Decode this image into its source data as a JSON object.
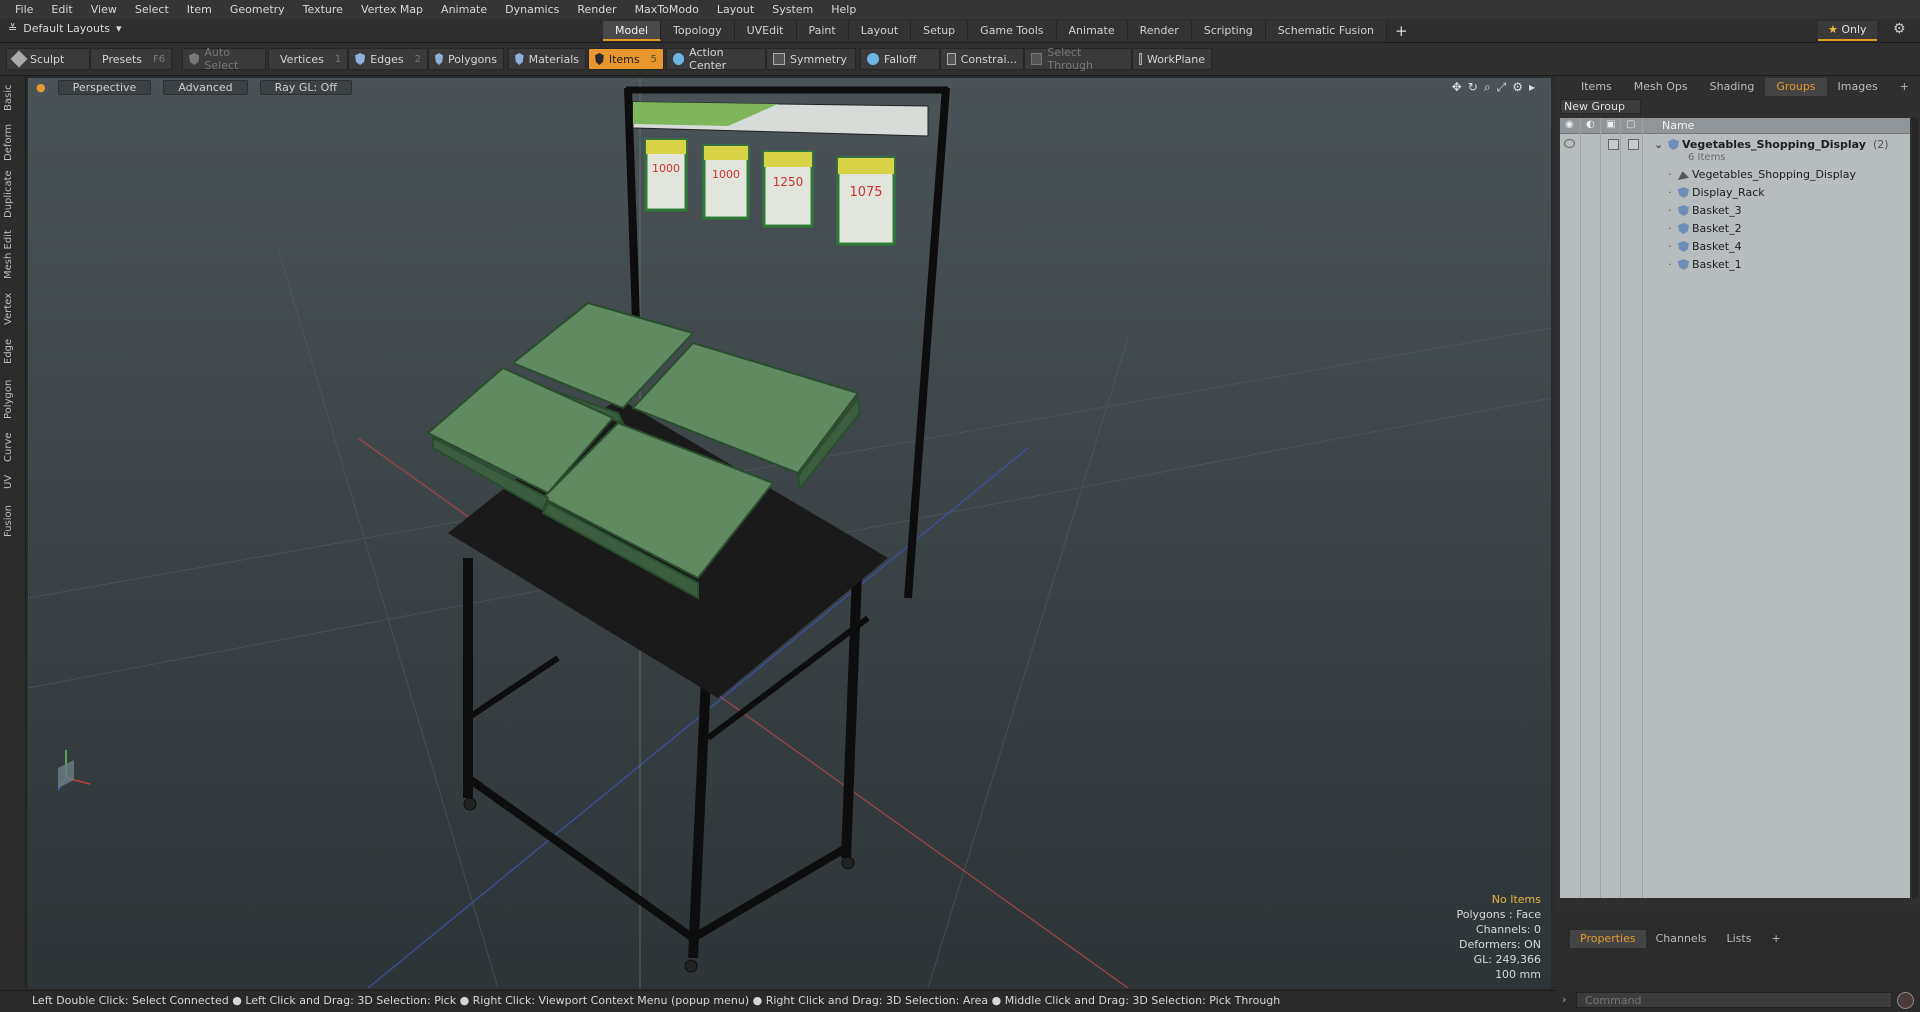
{
  "menu": [
    "File",
    "Edit",
    "View",
    "Select",
    "Item",
    "Geometry",
    "Texture",
    "Vertex Map",
    "Animate",
    "Dynamics",
    "Render",
    "MaxToModo",
    "Layout",
    "System",
    "Help"
  ],
  "layoutbar": {
    "layout_label": "Default Layouts",
    "tabs": [
      "Model",
      "Topology",
      "UVEdit",
      "Paint",
      "Layout",
      "Setup",
      "Game Tools",
      "Animate",
      "Render",
      "Scripting",
      "Schematic Fusion"
    ],
    "active_tab": "Model",
    "only_label": "Only"
  },
  "toolbar": {
    "sculpt": "Sculpt",
    "presets": "Presets",
    "presets_key": "F6",
    "auto_select": "Auto Select",
    "vertices": "Vertices",
    "vertices_key": "1",
    "edges": "Edges",
    "edges_key": "2",
    "polygons": "Polygons",
    "materials": "Materials",
    "items": "Items",
    "items_key": "5",
    "action_center": "Action Center",
    "symmetry": "Symmetry",
    "falloff": "Falloff",
    "constrain": "Constrai...",
    "select_through": "Select Through",
    "workplane": "WorkPlane"
  },
  "left_tabs": [
    "Basic",
    "Deform",
    "Duplicate",
    "Mesh Edit",
    "Vertex",
    "Edge",
    "Polygon",
    "Curve",
    "UV",
    "Fusion"
  ],
  "viewport": {
    "perspective": "Perspective",
    "advanced": "Advanced",
    "raygl": "Ray GL: Off",
    "info": {
      "no_items": "No Items",
      "polygons": "Polygons : Face",
      "channels": "Channels: 0",
      "deformers": "Deformers: ON",
      "gl": "GL: 249,366",
      "scale": "100 mm"
    },
    "sign_numbers": [
      "1000",
      "1000",
      "1250",
      "1075"
    ]
  },
  "right_panel": {
    "tabs": [
      "Items",
      "Mesh Ops",
      "Shading",
      "Groups",
      "Images"
    ],
    "active_tab": "Groups",
    "new_group": "New Group",
    "name_header": "Name",
    "group_name": "Vegetables_Shopping_Display",
    "group_count": "(2)",
    "items_count": "6 Items",
    "children": [
      "Vegetables_Shopping_Display",
      "Display_Rack",
      "Basket_3",
      "Basket_2",
      "Basket_4",
      "Basket_1"
    ]
  },
  "properties": {
    "tabs": [
      "Properties",
      "Channels",
      "Lists"
    ],
    "active_tab": "Properties",
    "command_placeholder": "Command"
  },
  "status": "Left Double Click: Select Connected ● Left Click and Drag: 3D Selection: Pick ● Right Click: Viewport Context Menu (popup menu) ● Right Click and Drag: 3D Selection: Area ● Middle Click and Drag: 3D Selection: Pick Through",
  "colors": {
    "accent": "#e8962e",
    "basket": "#5f8a62",
    "frame": "#141414"
  }
}
